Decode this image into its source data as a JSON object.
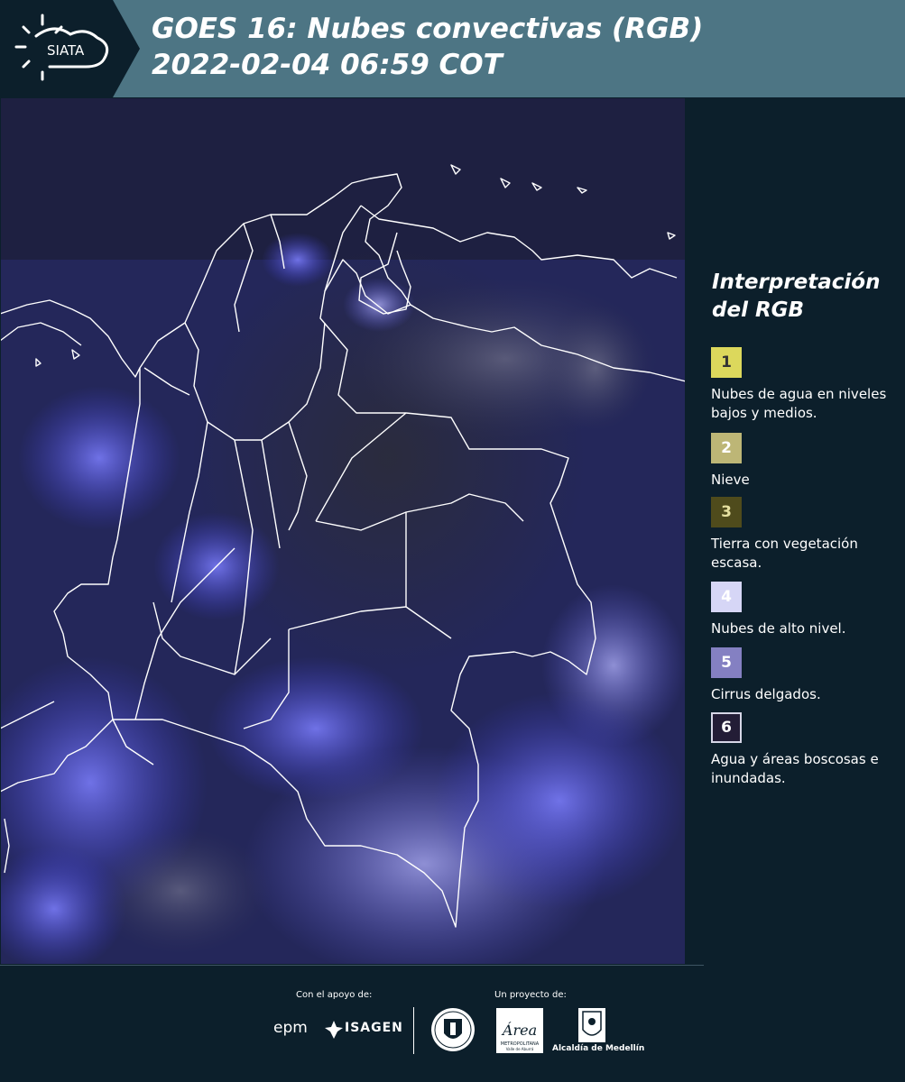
{
  "header": {
    "logo_text": "SIATA",
    "title_line1": "GOES 16: Nubes convectivas (RGB)",
    "title_line2": " 2022-02-04 06:59 COT"
  },
  "legend": {
    "title_line1": "Interpretación",
    "title_line2": "del RGB",
    "items": [
      {
        "number": "1",
        "label": "Nubes de agua en niveles bajos y medios.",
        "color": "#dcd85c"
      },
      {
        "number": "2",
        "label": "Nieve",
        "color": "#bdb676"
      },
      {
        "number": "3",
        "label": "Tierra con vegetación escasa.",
        "color": "#4f4b1c"
      },
      {
        "number": "4",
        "label": "Nubes de alto nivel.",
        "color": "#d6d6f6"
      },
      {
        "number": "5",
        "label": "Cirrus delgados.",
        "color": "#8480c2"
      },
      {
        "number": "6",
        "label": "Agua y áreas boscosas e inundadas.",
        "color": "#231d36"
      }
    ]
  },
  "footer": {
    "support_label": "Con el apoyo de:",
    "project_label": "Un proyecto de:",
    "epm": "epm",
    "isagen": "ISAGEN",
    "area_label": "Área",
    "metropolitana": "METROPOLITANA",
    "valle": "Valle de Aburrá",
    "alcaldia": "Alcaldía de Medellín"
  }
}
